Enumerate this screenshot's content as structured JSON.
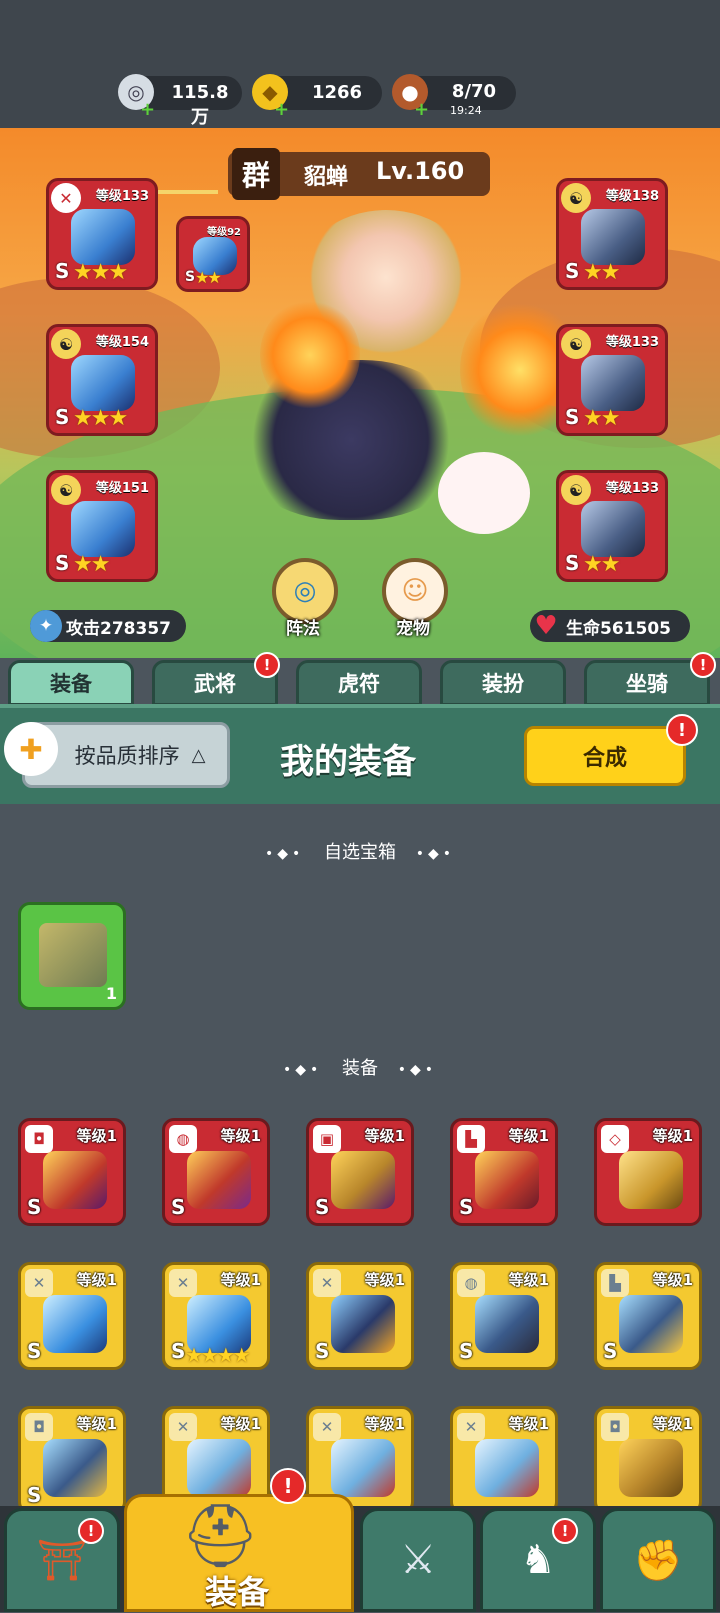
{
  "currency": {
    "silver": {
      "value": "115.8万",
      "icon": "silver-coin-icon"
    },
    "gold": {
      "value": "1266",
      "icon": "gold-ingot-icon"
    },
    "stamina": {
      "value": "8/70",
      "timer": "19:24",
      "icon": "meat-icon"
    }
  },
  "hero": {
    "faction": "群",
    "name": "貂蝉",
    "level": "Lv.160"
  },
  "left_equips": [
    {
      "level": "等级133",
      "badge": "sword",
      "rank": "S",
      "stars": "★★★"
    },
    {
      "level": "等级154",
      "badge": "yin-yang",
      "rank": "S",
      "stars": "★★★"
    },
    {
      "level": "等级151",
      "badge": "yin-yang",
      "rank": "S",
      "stars": "★★"
    }
  ],
  "linked_equip": {
    "level": "等级92",
    "rank": "S",
    "stars": "★★"
  },
  "right_equips": [
    {
      "level": "等级138",
      "badge": "yin-yang",
      "rank": "S",
      "stars": "★★"
    },
    {
      "level": "等级133",
      "badge": "yin-yang",
      "rank": "S",
      "stars": "★★"
    },
    {
      "level": "等级133",
      "badge": "yin-yang",
      "rank": "S",
      "stars": "★★"
    }
  ],
  "stats": {
    "attack": "攻击278357",
    "hp": "生命561505"
  },
  "buttons": {
    "formation": "阵法",
    "pet": "宠物"
  },
  "tabs": [
    {
      "label": "装备",
      "active": true,
      "dot": false
    },
    {
      "label": "武将",
      "active": false,
      "dot": true
    },
    {
      "label": "虎符",
      "active": false,
      "dot": false
    },
    {
      "label": "装扮",
      "active": false,
      "dot": false
    },
    {
      "label": "坐骑",
      "active": false,
      "dot": true
    }
  ],
  "panel": {
    "sort_label": "按品质排序",
    "sort_arrow": "△",
    "title": "我的装备",
    "synth_label": "合成",
    "alert": "!"
  },
  "sections": {
    "chest_title": "自选宝箱",
    "chest_count": "1",
    "equip_title": "装备"
  },
  "items": [
    {
      "level": "等级1",
      "color": "red",
      "rank": "S",
      "stars": ""
    },
    {
      "level": "等级1",
      "color": "red",
      "rank": "S",
      "stars": ""
    },
    {
      "level": "等级1",
      "color": "red",
      "rank": "S",
      "stars": ""
    },
    {
      "level": "等级1",
      "color": "red",
      "rank": "S",
      "stars": ""
    },
    {
      "level": "等级1",
      "color": "red",
      "rank": "",
      "stars": ""
    },
    {
      "level": "等级1",
      "color": "gold",
      "rank": "S",
      "stars": ""
    },
    {
      "level": "等级1",
      "color": "gold",
      "rank": "S",
      "stars": "★★★★"
    },
    {
      "level": "等级1",
      "color": "gold",
      "rank": "S",
      "stars": ""
    },
    {
      "level": "等级1",
      "color": "gold",
      "rank": "S",
      "stars": ""
    },
    {
      "level": "等级1",
      "color": "gold",
      "rank": "S",
      "stars": ""
    },
    {
      "level": "等级1",
      "color": "gold",
      "rank": "S",
      "stars": ""
    },
    {
      "level": "等级1",
      "color": "gold",
      "rank": "",
      "stars": ""
    },
    {
      "level": "等级1",
      "color": "gold",
      "rank": "",
      "stars": ""
    },
    {
      "level": "等级1",
      "color": "gold",
      "rank": "",
      "stars": ""
    },
    {
      "level": "等级1",
      "color": "gold",
      "rank": "",
      "stars": ""
    }
  ],
  "nav": {
    "active_label": "装备",
    "alert": "!"
  }
}
